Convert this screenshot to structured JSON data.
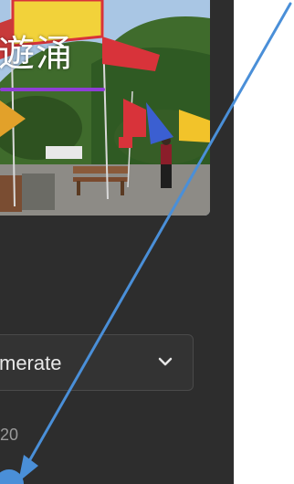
{
  "image": {
    "overlay_text": "遊涌",
    "underline_color": "#8f3ed6"
  },
  "dropdown": {
    "selected_value": "merate"
  },
  "field": {
    "value": "20"
  },
  "annotation": {
    "arrow_color": "#4a8fd8",
    "arrow_icon": "arrow-icon"
  }
}
